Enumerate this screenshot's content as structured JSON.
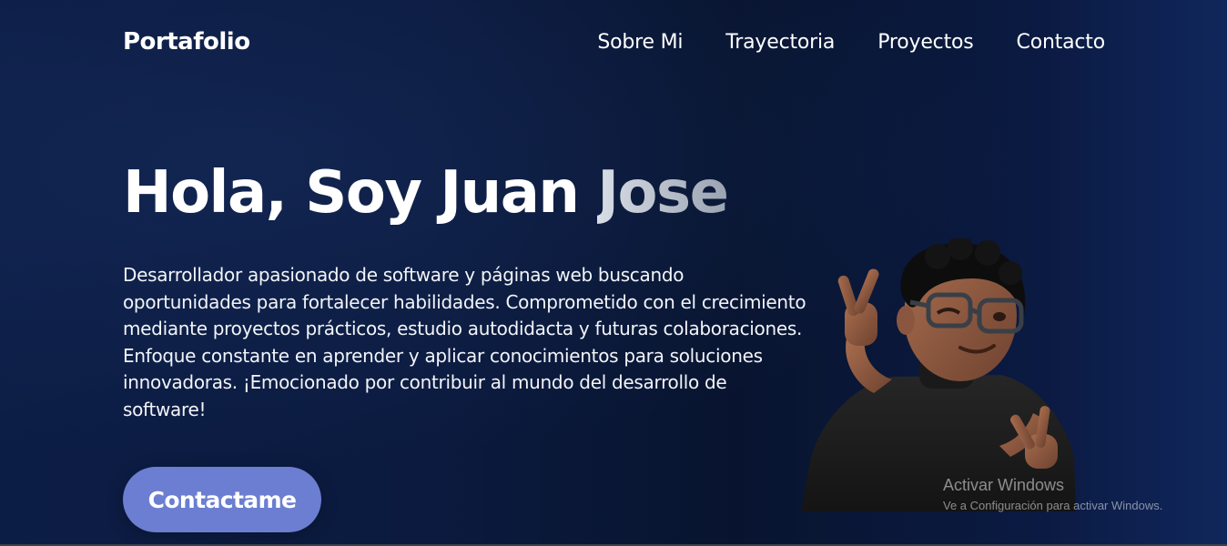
{
  "header": {
    "brand": "Portafolio",
    "nav": [
      {
        "label": "Sobre Mi"
      },
      {
        "label": "Trayectoria"
      },
      {
        "label": "Proyectos"
      },
      {
        "label": "Contacto"
      }
    ]
  },
  "hero": {
    "title_main": "Hola, Soy Juan ",
    "title_accent": "Jose",
    "description": "Desarrollador apasionado de software y páginas web buscando oportunidades para fortalecer habilidades. Comprometido con el crecimiento mediante proyectos prácticos, estudio autodidacta y futuras colaboraciones. Enfoque constante en aprender y aplicar conocimientos para soluciones innovadoras. ¡Emocionado por contribuir al mundo del desarrollo de software!",
    "cta_label": "Contactame"
  },
  "watermark": {
    "title": "Activar Windows",
    "subtitle": "Ve a Configuración para activar Windows."
  },
  "colors": {
    "background": "#0b1a3e",
    "cta": "#6b7ed1",
    "text": "#ffffff"
  },
  "icons": {
    "avatar": "3d-avatar-peace-sign"
  }
}
